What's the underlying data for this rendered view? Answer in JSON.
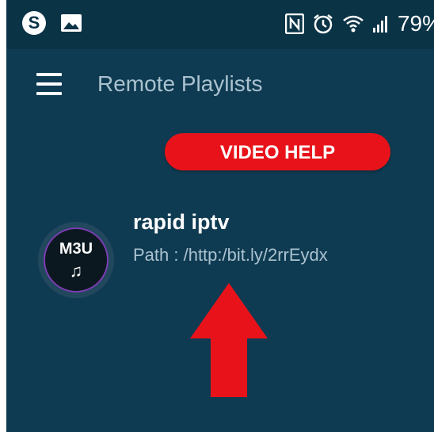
{
  "status_bar": {
    "skype_glyph": "S",
    "battery": "79%",
    "icons": [
      "skype-icon",
      "image-icon",
      "nfc-icon",
      "alarm-icon",
      "wifi-icon",
      "signal-icon"
    ]
  },
  "app_bar": {
    "title": "Remote Playlists",
    "menu_icon": "hamburger-menu-icon"
  },
  "video_help": {
    "label": "VIDEO HELP",
    "color": "#e8131a"
  },
  "playlist": {
    "items": [
      {
        "name": "rapid iptv",
        "path": "Path : /http:/bit.ly/2rrEydx",
        "badge": "M3U",
        "badge_glyph": "♫"
      }
    ]
  },
  "annotation": {
    "arrow_color": "#e8131a"
  },
  "colors": {
    "background": "#0f3b52",
    "status_bar": "#0b3346",
    "secondary_text": "#aac2cf"
  }
}
